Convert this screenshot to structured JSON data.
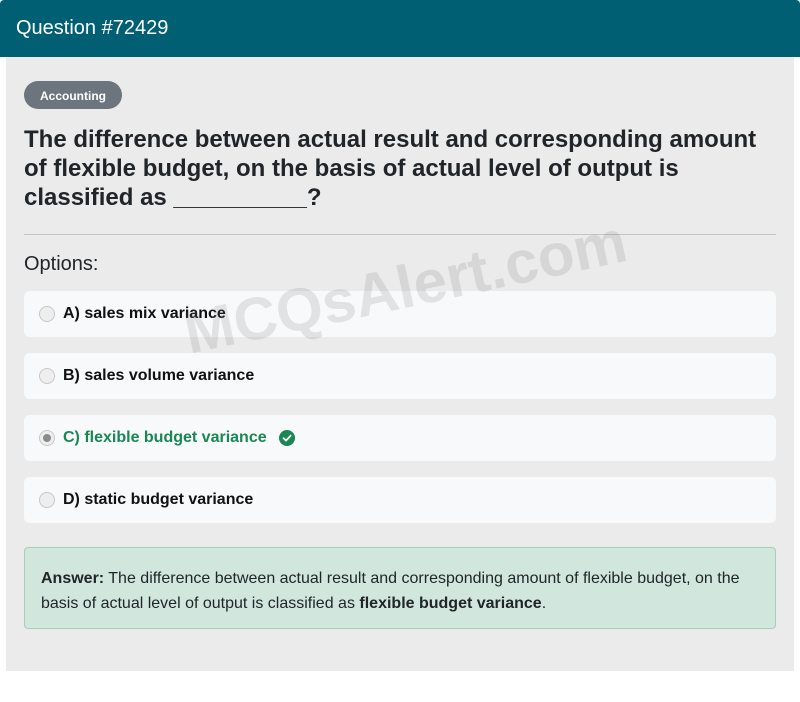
{
  "header": {
    "title": "Question #72429"
  },
  "badge": {
    "label": "Accounting"
  },
  "question": {
    "text": "The difference between actual result and corresponding amount of flexible budget, on the basis of actual level of output is classified as __________?"
  },
  "options": {
    "heading": "Options:",
    "items": [
      {
        "label": "A) sales mix variance",
        "correct": false
      },
      {
        "label": "B) sales volume variance",
        "correct": false
      },
      {
        "label": "C) flexible budget variance",
        "correct": true
      },
      {
        "label": "D) static budget variance",
        "correct": false
      }
    ]
  },
  "answer": {
    "prefix": "Answer:",
    "text": "The difference between actual result and corresponding amount of flexible budget, on the basis of actual level of output is classified as",
    "highlight": "flexible budget variance",
    "suffix": "."
  },
  "watermark": {
    "text": "MCQsAlert.com"
  },
  "colors": {
    "header": "#005f73",
    "correct": "#198754",
    "answer_bg": "#d1e7dd"
  }
}
